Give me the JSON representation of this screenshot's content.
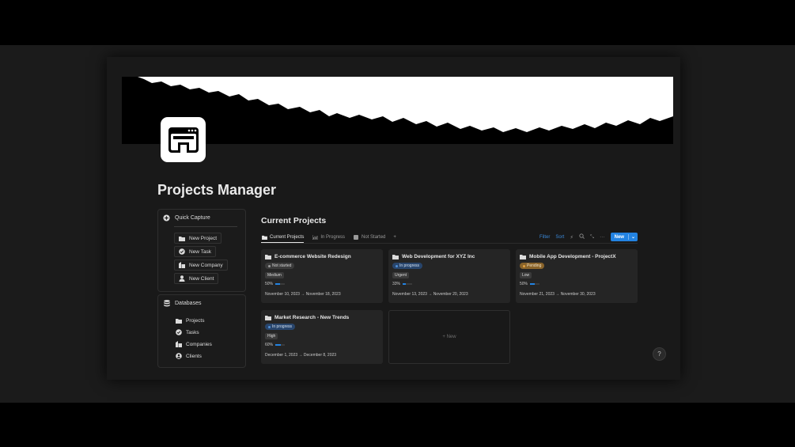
{
  "page": {
    "title": "Projects Manager"
  },
  "quick_capture": {
    "title": "Quick Capture",
    "buttons": [
      {
        "label": "New Project",
        "icon": "folder-icon"
      },
      {
        "label": "New Task",
        "icon": "check-circle-icon"
      },
      {
        "label": "New Company",
        "icon": "building-icon"
      },
      {
        "label": "New Client",
        "icon": "person-icon"
      }
    ]
  },
  "databases": {
    "title": "Databases",
    "items": [
      {
        "label": "Projects",
        "icon": "folder-icon"
      },
      {
        "label": "Tasks",
        "icon": "check-circle-icon"
      },
      {
        "label": "Companies",
        "icon": "building-icon"
      },
      {
        "label": "Clients",
        "icon": "person-circle-icon"
      }
    ]
  },
  "main": {
    "title": "Current Projects",
    "tabs": [
      {
        "label": "Current Projects",
        "icon": "folder-icon",
        "active": true
      },
      {
        "label": "In Progress",
        "icon": "chart-icon",
        "active": false
      },
      {
        "label": "Not Started",
        "icon": "square-icon",
        "active": false
      }
    ],
    "add_tab": "+",
    "actions": {
      "filter": "Filter",
      "sort": "Sort",
      "new": "New"
    },
    "new_card_label": "+ New"
  },
  "projects": [
    {
      "title": "E-commerce Website Redesign",
      "status": "Not started",
      "priority": "Medium",
      "progress": "50%",
      "progress_value": 0.5,
      "dates": "November 10, 2023 → November 18, 2023"
    },
    {
      "title": "Web Development for XYZ Inc",
      "status": "In progress",
      "priority": "Urgent",
      "progress": "33%",
      "progress_value": 0.33,
      "dates": "November 13, 2023 → November 20, 2023"
    },
    {
      "title": "Mobile App Development - ProjectX",
      "status": "Pending",
      "priority": "Low",
      "progress": "50%",
      "progress_value": 0.5,
      "dates": "November 21, 2023 → November 30, 2023"
    },
    {
      "title": "Market Research - New Trends",
      "status": "In progress",
      "priority": "High",
      "progress": "60%",
      "progress_value": 0.6,
      "dates": "December 1, 2023 → December 8, 2023"
    }
  ],
  "colors": {
    "accent": "#2383e2",
    "status_not_started_bg": "#3b3b3b",
    "status_in_progress_bg": "#28456c",
    "status_pending_bg": "#89632a"
  },
  "help": "?"
}
